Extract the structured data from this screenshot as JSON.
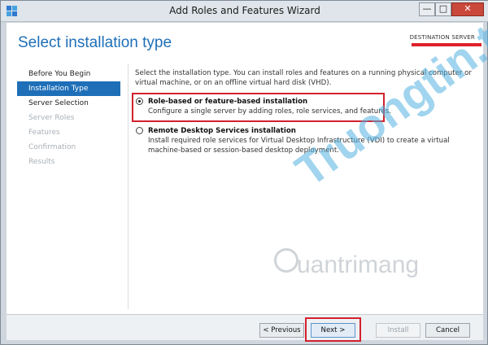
{
  "window": {
    "title": "Add Roles and Features Wizard",
    "buttons": {
      "minimize": "—",
      "maximize": "□",
      "close": "✕"
    }
  },
  "header": {
    "title": "Select installation type",
    "destination_label": "DESTINATION SERVER"
  },
  "nav": {
    "items": [
      {
        "label": "Before You Begin",
        "state": "normal"
      },
      {
        "label": "Installation Type",
        "state": "active"
      },
      {
        "label": "Server Selection",
        "state": "normal"
      },
      {
        "label": "Server Roles",
        "state": "disabled"
      },
      {
        "label": "Features",
        "state": "disabled"
      },
      {
        "label": "Confirmation",
        "state": "disabled"
      },
      {
        "label": "Results",
        "state": "disabled"
      }
    ]
  },
  "main": {
    "intro": "Select the installation type. You can install roles and features on a running physical computer or virtual machine, or on an offline virtual hard disk (VHD).",
    "options": [
      {
        "title": "Role-based or feature-based installation",
        "description": "Configure a single server by adding roles, role services, and features.",
        "selected": true
      },
      {
        "title": "Remote Desktop Services installation",
        "description": "Install required role services for Virtual Desktop Infrastructure (VDI) to create a virtual machine-based or session-based desktop deployment.",
        "selected": false
      }
    ]
  },
  "footer": {
    "previous": "< Previous",
    "next": "Next >",
    "install": "Install",
    "cancel": "Cancel"
  },
  "watermark": {
    "primary": "Truongtin.top",
    "secondary": "uantrimang"
  },
  "colors": {
    "accent": "#1e6fb8",
    "highlight": "#d3212d"
  }
}
